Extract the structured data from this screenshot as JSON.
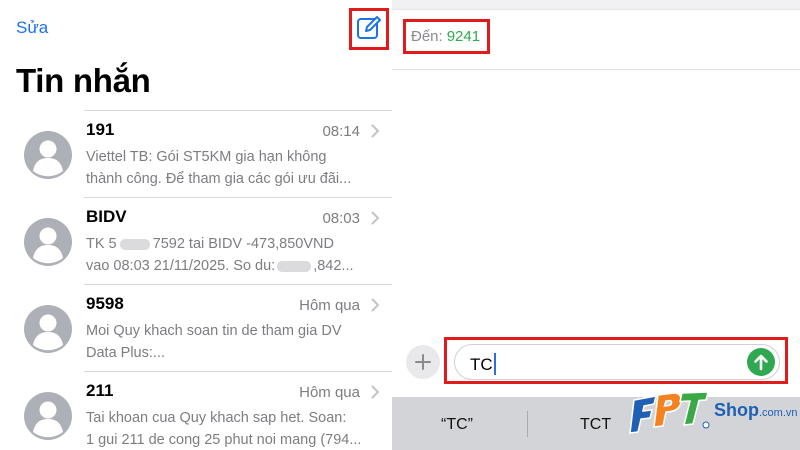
{
  "left_pane": {
    "edit_label": "Sửa",
    "title": "Tin nhắn",
    "messages": [
      {
        "sender": "191",
        "time": "08:14",
        "preview_line1": "Viettel TB: Gói ST5KM gia hạn không",
        "preview_line2": "thành công. Để tham gia các gói ưu đãi..."
      },
      {
        "sender": "BIDV",
        "time": "08:03",
        "preview_line1_a": "TK 5",
        "preview_line1_b": "7592 tai BIDV -473,850VND",
        "preview_line2_a": "vao 08:03 21/11/2025. So du:",
        "preview_line2_b": ",842..."
      },
      {
        "sender": "9598",
        "time": "Hôm qua",
        "preview_line1": "Moi Quy khach soan tin de tham gia DV",
        "preview_line2": "Data Plus:..."
      },
      {
        "sender": "211",
        "time": "Hôm qua",
        "preview_line1": "Tai khoan cua Quy khach sap het. Soan:",
        "preview_line2": "1 gui 211 de cong 25 phut noi mang (794..."
      }
    ]
  },
  "compose": {
    "to_label": "Đến:",
    "to_value": "9241",
    "input_value": "TC"
  },
  "suggestions": [
    "“TC”",
    "TCT"
  ],
  "logo": {
    "part1": "Shop",
    "part2": ".com.vn"
  },
  "colors": {
    "accent_blue": "#1a73e8",
    "highlight_red": "#e01b1b",
    "send_green": "#2fa84f",
    "fpt_blue": "#1f5fb4",
    "fpt_orange": "#f58220",
    "fpt_green": "#3aa845"
  }
}
